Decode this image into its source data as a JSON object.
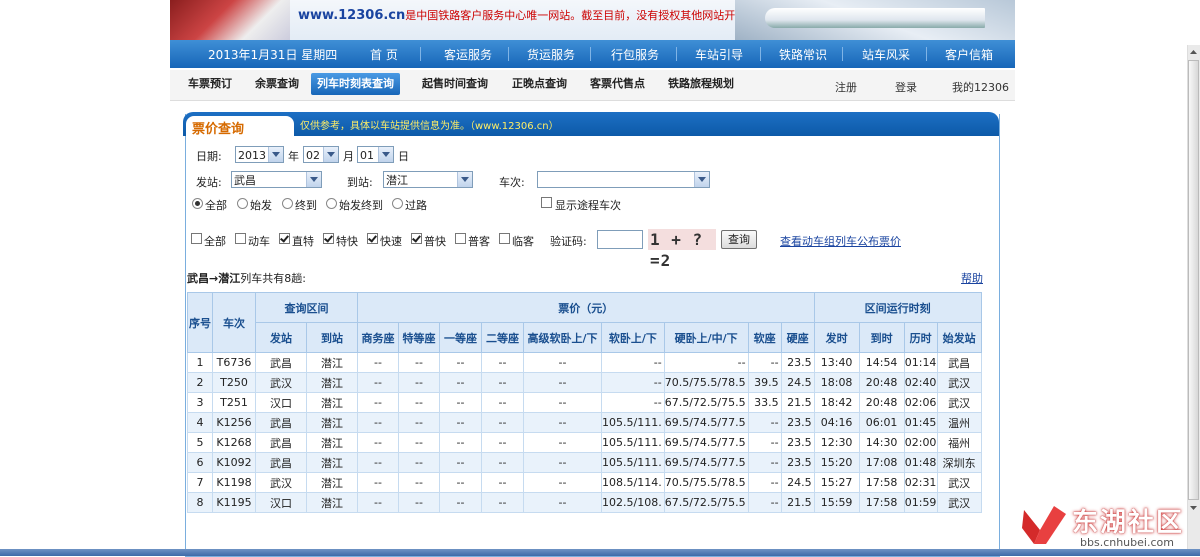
{
  "banner": {
    "url": "www.12306.cn",
    "text": "是中国铁路客户服务中心唯一网站。截至目前，没有授权其他网站开"
  },
  "mainnav": {
    "date": "2013年1月31日 星期四",
    "items": [
      "首 页",
      "客运服务",
      "货运服务",
      "行包服务",
      "车站引导",
      "铁路常识",
      "站车风采",
      "客户信箱"
    ]
  },
  "subnav": {
    "items": [
      "车票预订",
      "余票查询",
      "列车时刻表查询",
      "起售时间查询",
      "正晚点查询",
      "客票代售点",
      "铁路旅程规划"
    ],
    "active": "列车时刻表查询",
    "register": "注册",
    "login": "登录",
    "my": "我的12306"
  },
  "panel": {
    "title": "票价查询",
    "note": "仅供参考，具体以车站提供信息为准。（www.12306.cn）"
  },
  "form": {
    "date_label": "日期:",
    "year": "2013",
    "year_unit": "年",
    "month": "02",
    "month_unit": "月",
    "day": "01",
    "day_unit": "日",
    "from_label": "发站:",
    "from_value": "武昌",
    "to_label": "到站:",
    "to_value": "潜江",
    "train_label": "车次:",
    "train_value": "",
    "station_options": [
      "全部",
      "始发",
      "终到",
      "始发终到",
      "过路"
    ],
    "show_passing_label": "显示途程车次",
    "train_types": [
      {
        "label": "全部",
        "checked": false
      },
      {
        "label": "动车",
        "checked": false
      },
      {
        "label": "直特",
        "checked": true
      },
      {
        "label": "特快",
        "checked": true
      },
      {
        "label": "快速",
        "checked": true
      },
      {
        "label": "普快",
        "checked": true
      },
      {
        "label": "普客",
        "checked": false
      },
      {
        "label": "临客",
        "checked": false
      }
    ],
    "captcha_label": "验证码:",
    "captcha_image_text": "1 + ?=2",
    "query_button": "查询",
    "emu_link": "查看动车组列车公布票价"
  },
  "result": {
    "route": "武昌→潜江",
    "summary": "列车共有8趟:",
    "help": "帮助"
  },
  "table": {
    "group_headers": [
      "序号",
      "车次",
      "查询区间",
      "票价（元）",
      "区间运行时刻"
    ],
    "sub_headers": [
      "发站",
      "到站",
      "商务座",
      "特等座",
      "一等座",
      "二等座",
      "高级软卧上/下",
      "软卧上/下",
      "硬卧上/中/下",
      "软座",
      "硬座",
      "发时",
      "到时",
      "历时",
      "始发站"
    ],
    "rows": [
      [
        "1",
        "T6736",
        "武昌",
        "潜江",
        "--",
        "--",
        "--",
        "--",
        "--",
        "--",
        "--",
        "--",
        "23.5",
        "13:40",
        "14:54",
        "01:14",
        "武昌"
      ],
      [
        "2",
        "T250",
        "武汉",
        "潜江",
        "--",
        "--",
        "--",
        "--",
        "--",
        "--",
        "70.5/75.5/78.5",
        "39.5",
        "24.5",
        "18:08",
        "20:48",
        "02:40",
        "武汉"
      ],
      [
        "3",
        "T251",
        "汉口",
        "潜江",
        "--",
        "--",
        "--",
        "--",
        "--",
        "--",
        "67.5/72.5/75.5",
        "33.5",
        "21.5",
        "18:42",
        "20:48",
        "02:06",
        "武汉"
      ],
      [
        "4",
        "K1256",
        "武昌",
        "潜江",
        "--",
        "--",
        "--",
        "--",
        "--",
        "105.5/111.",
        "69.5/74.5/77.5",
        "--",
        "23.5",
        "04:16",
        "06:01",
        "01:45",
        "温州"
      ],
      [
        "5",
        "K1268",
        "武昌",
        "潜江",
        "--",
        "--",
        "--",
        "--",
        "--",
        "105.5/111.",
        "69.5/74.5/77.5",
        "--",
        "23.5",
        "12:30",
        "14:30",
        "02:00",
        "福州"
      ],
      [
        "6",
        "K1092",
        "武昌",
        "潜江",
        "--",
        "--",
        "--",
        "--",
        "--",
        "105.5/111.",
        "69.5/74.5/77.5",
        "--",
        "23.5",
        "15:20",
        "17:08",
        "01:48",
        "深圳东"
      ],
      [
        "7",
        "K1198",
        "武汉",
        "潜江",
        "--",
        "--",
        "--",
        "--",
        "--",
        "108.5/114.",
        "70.5/75.5/78.5",
        "--",
        "24.5",
        "15:27",
        "17:58",
        "02:31",
        "武汉"
      ],
      [
        "8",
        "K1195",
        "汉口",
        "潜江",
        "--",
        "--",
        "--",
        "--",
        "--",
        "102.5/108.",
        "67.5/72.5/75.5",
        "--",
        "21.5",
        "15:59",
        "17:58",
        "01:59",
        "武汉"
      ]
    ]
  },
  "watermark": {
    "name": "东湖社区",
    "url": "bbs.cnhubei.com"
  },
  "colors": {
    "nav_blue": "#1766b8",
    "panel_blue": "#0d5aa8",
    "title_orange": "#d66a00",
    "link_blue": "#1a44a0"
  }
}
